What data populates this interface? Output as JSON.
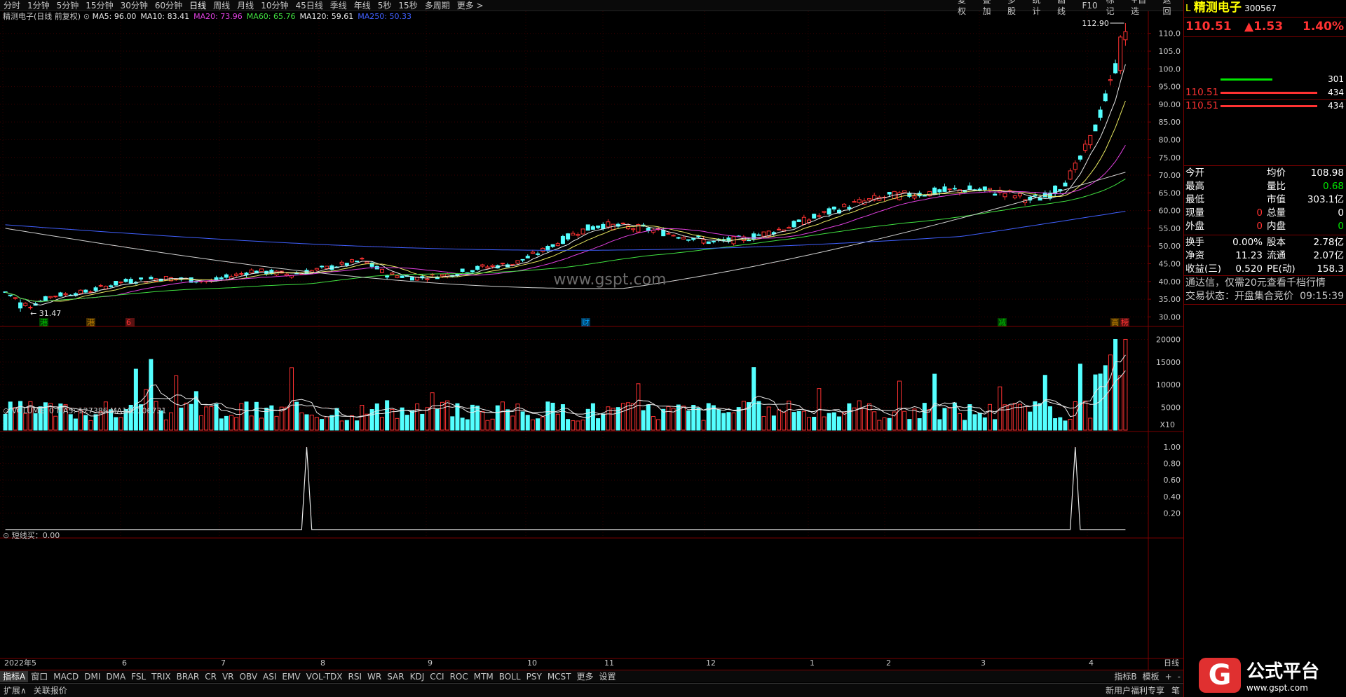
{
  "toolbar": {
    "periods": [
      "分时",
      "1分钟",
      "5分钟",
      "15分钟",
      "30分钟",
      "60分钟",
      "日线",
      "周线",
      "月线",
      "10分钟",
      "45日线",
      "季线",
      "年线",
      "5秒",
      "15秒",
      "多周期",
      "更多 >"
    ],
    "active_period": "日线",
    "right_items": [
      "复权",
      "叠加",
      "多股",
      "统计",
      "画线",
      "F10",
      "标记",
      "+自选",
      "返回"
    ]
  },
  "main_chart": {
    "stock_label": "精测电子(日线 前复权)",
    "ma_legend": [
      {
        "label": "MA5: 96.00",
        "color": "#e8e8e8"
      },
      {
        "label": "MA10: 83.41",
        "color": "#e8e8e8"
      },
      {
        "label": "MA20: 73.96",
        "color": "#e040e0"
      },
      {
        "label": "MA60: 65.76",
        "color": "#40e040"
      },
      {
        "label": "MA120: 59.61",
        "color": "#e8e8e8"
      },
      {
        "label": "MA250: 50.33",
        "color": "#4060ff"
      }
    ],
    "price_axis": [
      "110.0",
      "105.0",
      "100.0",
      "95.00",
      "90.00",
      "85.00",
      "80.00",
      "75.00",
      "70.00",
      "65.00",
      "60.00",
      "55.00",
      "50.00",
      "45.00",
      "40.00",
      "35.00",
      "30.00"
    ],
    "high_label": "112.90",
    "low_label": "31.47",
    "watermark": "www.gspt.com",
    "event_tags": [
      {
        "text": "港",
        "color": "#00c000"
      },
      {
        "text": "港",
        "color": "#c08000"
      },
      {
        "text": "6",
        "color": "#ff3232"
      },
      {
        "text": "财",
        "color": "#00a0ff"
      },
      {
        "text": "减",
        "color": "#00c000"
      },
      {
        "text": "高",
        "color": "#c08000"
      },
      {
        "text": "榜",
        "color": "#ff3232"
      }
    ]
  },
  "volume_chart": {
    "legend": "VOLUME: 0  MA5: 127386  MA10: 106731",
    "axis": [
      "20000",
      "15000",
      "10000",
      "5000"
    ],
    "unit": "X10"
  },
  "signal_chart": {
    "legend": "短线买：0.00",
    "axis": [
      "1.00",
      "0.80",
      "0.60",
      "0.40",
      "0.20"
    ]
  },
  "date_axis": [
    "2022年5",
    "6",
    "7",
    "8",
    "9",
    "10",
    "11",
    "12",
    "1",
    "2",
    "3",
    "4"
  ],
  "date_axis_right": "日线",
  "indicator_tabs": [
    "指标A",
    "窗口",
    "MACD",
    "DMI",
    "DMA",
    "FSL",
    "TRIX",
    "BRAR",
    "CR",
    "VR",
    "OBV",
    "ASI",
    "EMV",
    "VOL-TDX",
    "RSI",
    "WR",
    "SAR",
    "KDJ",
    "CCI",
    "ROC",
    "MTM",
    "BOLL",
    "PSY",
    "MCST",
    "更多",
    "设置"
  ],
  "indicator_right": [
    "指标B",
    "模板",
    "+",
    "-"
  ],
  "status_bar": [
    "扩展∧",
    "关联报价"
  ],
  "status_bar_right": [
    "新用户福利专享",
    "笔"
  ],
  "quote": {
    "prefix": "L",
    "name": "精测电子",
    "code": "300567",
    "price": "110.51",
    "change": "▲1.53",
    "change_pct": "1.40%",
    "orders": [
      {
        "price": "",
        "qty": "301",
        "bar_color": "#00e600"
      },
      {
        "price": "110.51",
        "qty": "434",
        "bar_color": "#ff3232"
      },
      {
        "price": "110.51",
        "qty": "434",
        "bar_color": "#ff3232"
      }
    ],
    "stats": [
      {
        "l1": "今开",
        "v1": "",
        "l2": "均价",
        "v2": "108.98"
      },
      {
        "l1": "最高",
        "v1": "",
        "l2": "量比",
        "v2": "0.68"
      },
      {
        "l1": "最低",
        "v1": "",
        "l2": "市值",
        "v2": "303.1亿"
      },
      {
        "l1": "现量",
        "v1": "0",
        "l2": "总量",
        "v2": "0"
      },
      {
        "l1": "外盘",
        "v1": "0",
        "l2": "内盘",
        "v2": "0"
      }
    ],
    "stats2": [
      {
        "l1": "换手",
        "v1": "0.00%",
        "l2": "股本",
        "v2": "2.78亿"
      },
      {
        "l1": "净资",
        "v1": "11.23",
        "l2": "流通",
        "v2": "2.07亿"
      },
      {
        "l1": "收益(三)",
        "v1": "0.520",
        "l2": "PE(动)",
        "v2": "158.3"
      }
    ],
    "notice": "通达信，仅需20元查看千档行情",
    "trade_status_label": "交易状态：开盘集合竞价",
    "trade_time": "09:15:39"
  },
  "brand": {
    "logo_char": "G",
    "title": "公式平台",
    "url": "www.gspt.com"
  },
  "colors": {
    "up": "#ff3232",
    "down": "#54ffff",
    "grid": "#7a0000",
    "bg": "#000000"
  }
}
